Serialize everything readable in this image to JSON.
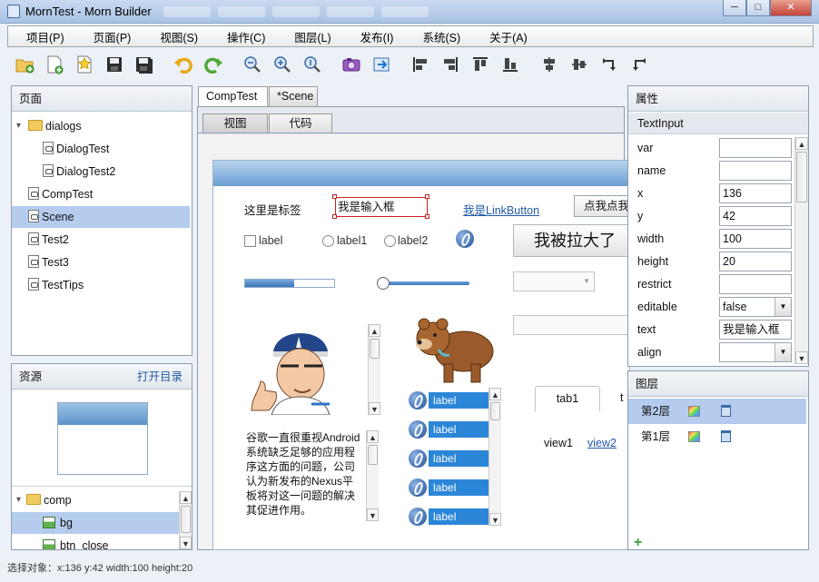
{
  "window": {
    "title": "MornTest - Morn Builder",
    "min": "─",
    "max": "□",
    "close": "✕"
  },
  "menu": [
    "项目(P)",
    "页面(P)",
    "视图(S)",
    "操作(C)",
    "图层(L)",
    "发布(I)",
    "系统(S)",
    "关于(A)"
  ],
  "toolbar_icons": [
    "new-folder-icon",
    "new-file-icon",
    "new-star-icon",
    "save-icon",
    "save-all-icon",
    "undo-icon",
    "redo-icon",
    "zoom-out-icon",
    "zoom-in-icon",
    "zoom-reset-icon",
    "camera-icon",
    "import-icon",
    "align-left-icon",
    "align-right-icon",
    "align-top-icon",
    "align-bottom-icon",
    "align-center-h-icon",
    "align-center-v-icon",
    "rotate-cw-icon",
    "rotate-ccw-icon"
  ],
  "pages": {
    "title": "页面",
    "items": [
      {
        "label": "dialogs",
        "type": "folder",
        "level": 0
      },
      {
        "label": "DialogTest",
        "type": "file",
        "level": 1
      },
      {
        "label": "DialogTest2",
        "type": "file",
        "level": 1
      },
      {
        "label": "CompTest",
        "type": "file",
        "level": 0
      },
      {
        "label": "Scene",
        "type": "file",
        "level": 0,
        "selected": true
      },
      {
        "label": "Test2",
        "type": "file",
        "level": 0
      },
      {
        "label": "Test3",
        "type": "file",
        "level": 0
      },
      {
        "label": "TestTips",
        "type": "file",
        "level": 0
      }
    ]
  },
  "resources": {
    "title": "资源",
    "open_dir": "打开目录",
    "items": [
      {
        "label": "comp",
        "type": "folder"
      },
      {
        "label": "bg",
        "type": "image",
        "selected": true
      },
      {
        "label": "btn_close",
        "type": "image"
      }
    ]
  },
  "doc_tabs": [
    "CompTest",
    "*Scene"
  ],
  "view_tabs": [
    "视图",
    "代码"
  ],
  "canvas": {
    "label_text": "这里是标签",
    "textinput_value": "我是输入框",
    "link_button": "我是LinkButton",
    "click_button": "点我点我",
    "checkbox_label": "label",
    "radio1": "label1",
    "radio2": "label2",
    "big_button": "我被拉大了",
    "progress": 0.55,
    "slider": 0.05,
    "paragraph": "谷歌一直很重视Android系统缺乏足够的应用程序这方面的问题，公司认为新发布的Nexus平板将对这一问题的解决其促进作用。",
    "list_items": [
      "label",
      "label",
      "label",
      "label",
      "label"
    ],
    "tab1": "tab1",
    "tab2": "t",
    "view1": "view1",
    "view2": "view2"
  },
  "props": {
    "title": "属性",
    "component": "TextInput",
    "rows": [
      {
        "label": "var",
        "value": ""
      },
      {
        "label": "name",
        "value": ""
      },
      {
        "label": "x",
        "value": "136"
      },
      {
        "label": "y",
        "value": "42"
      },
      {
        "label": "width",
        "value": "100"
      },
      {
        "label": "height",
        "value": "20"
      },
      {
        "label": "restrict",
        "value": ""
      },
      {
        "label": "editable",
        "value": "false",
        "dropdown": true
      },
      {
        "label": "text",
        "value": "我是输入框"
      },
      {
        "label": "align",
        "value": "",
        "dropdown": true
      }
    ]
  },
  "layers": {
    "title": "图层",
    "items": [
      {
        "label": "第2层",
        "selected": true
      },
      {
        "label": "第1层"
      }
    ],
    "add": "+"
  },
  "status": "选择对象：x:136 y:42  width:100 height:20"
}
